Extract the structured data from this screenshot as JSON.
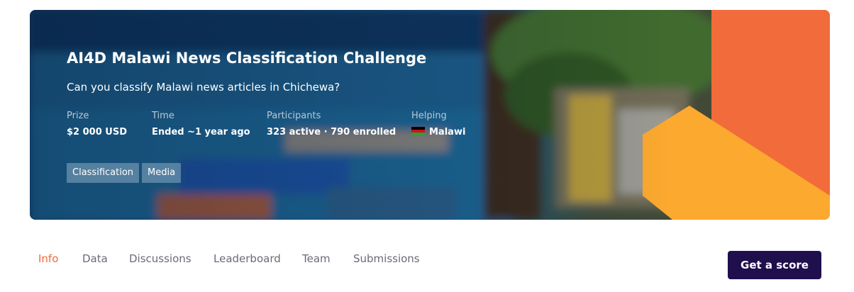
{
  "hero": {
    "title": "AI4D Malawi News Classification Challenge",
    "subtitle": "Can you classify Malawi news articles in Chichewa?",
    "stats": [
      {
        "label": "Prize",
        "value": "$2 000 USD"
      },
      {
        "label": "Time",
        "value": "Ended ~1 year ago"
      },
      {
        "label": "Participants",
        "value": "323 active · 790 enrolled"
      },
      {
        "label": "Helping",
        "value": "Malawi",
        "flag": "malawi-flag-icon"
      }
    ],
    "tags": [
      "Classification",
      "Media"
    ],
    "accent_colors": {
      "orange": "#F26B3A",
      "amber": "#FBA92F"
    }
  },
  "tabs": [
    {
      "label": "Info",
      "active": true
    },
    {
      "label": "Data",
      "active": false
    },
    {
      "label": "Discussions",
      "active": false
    },
    {
      "label": "Leaderboard",
      "active": false
    },
    {
      "label": "Team",
      "active": false
    },
    {
      "label": "Submissions",
      "active": false
    }
  ],
  "cta": {
    "label": "Get a score",
    "color": "#1F0F4D"
  }
}
